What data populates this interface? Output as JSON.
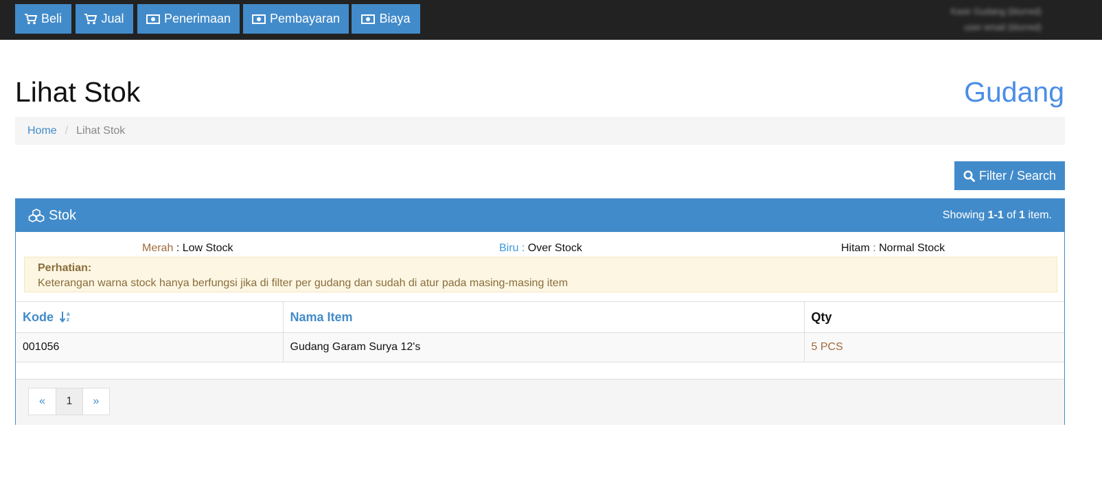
{
  "navbar": {
    "buttons": [
      {
        "label": "Beli",
        "icon": "cart-icon"
      },
      {
        "label": "Jual",
        "icon": "cart-icon"
      },
      {
        "label": "Penerimaan",
        "icon": "money-icon"
      },
      {
        "label": "Pembayaran",
        "icon": "money-icon"
      },
      {
        "label": "Biaya",
        "icon": "money-icon"
      }
    ],
    "user_line1": "Kasir Gudang (blurred)",
    "user_line2": "user email (blurred)"
  },
  "page": {
    "title": "Lihat Stok",
    "location": "Gudang"
  },
  "breadcrumb": {
    "home": "Home",
    "separator": "/",
    "current": "Lihat Stok"
  },
  "filter_button": {
    "label": "Filter / Search",
    "icon": "search-icon"
  },
  "panel": {
    "title": "Stok",
    "icon": "cubes-icon",
    "summary_prefix": "Showing ",
    "summary_range": "1-1",
    "summary_of": " of ",
    "summary_total": "1",
    "summary_suffix": " item."
  },
  "legend": {
    "red_key": "Merah",
    "red_text": "Low Stock",
    "blue_key": "Biru",
    "blue_text": "Over Stock",
    "black_key": "Hitam",
    "black_text": "Normal Stock",
    "colon": " : "
  },
  "alert": {
    "heading": "Perhatian:",
    "text": "Keterangan warna stock hanya berfungsi jika di filter per gudang dan sudah di atur pada masing-masing item"
  },
  "table": {
    "headers": {
      "kode": "Kode",
      "nama": "Nama Item",
      "qty": "Qty"
    },
    "rows": [
      {
        "kode": "001056",
        "nama": "Gudang Garam Surya 12's",
        "qty": "5 PCS"
      }
    ]
  },
  "pagination": {
    "prev": "«",
    "current": "1",
    "next": "»"
  },
  "colors": {
    "primary": "#428bca",
    "navbar": "#222222",
    "location": "#4a8de8",
    "low_stock": "#a0693b",
    "over_stock": "#3a99d8"
  }
}
